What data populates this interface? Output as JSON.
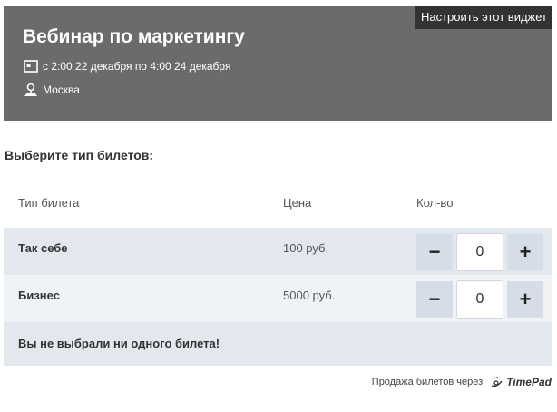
{
  "header": {
    "title": "Вебинар по маркетингу",
    "date": "с 2:00 22 декабря по 4:00 24 декабря",
    "location": "Москва",
    "configure_label": "Настроить этот виджет"
  },
  "tickets": {
    "choose_label": "Выберите тип билетов:",
    "columns": {
      "name": "Тип билета",
      "price": "Цена",
      "qty": "Кол-во"
    },
    "rows": [
      {
        "name": "Так себе",
        "price": "100 руб.",
        "qty": "0"
      },
      {
        "name": "Бизнес",
        "price": "5000 руб.",
        "qty": "0"
      }
    ],
    "minus_label": "−",
    "plus_label": "+",
    "empty_message": "Вы не выбрали ни одного билета!"
  },
  "powered_by": {
    "text": "Продажа билетов через",
    "brand": "TimePad"
  },
  "colors": {
    "header_bg": "#6b6b6b",
    "row_bg": "#e3e8ef",
    "row_alt_bg": "#f0f3f6",
    "button_bg": "#d6dde7"
  }
}
